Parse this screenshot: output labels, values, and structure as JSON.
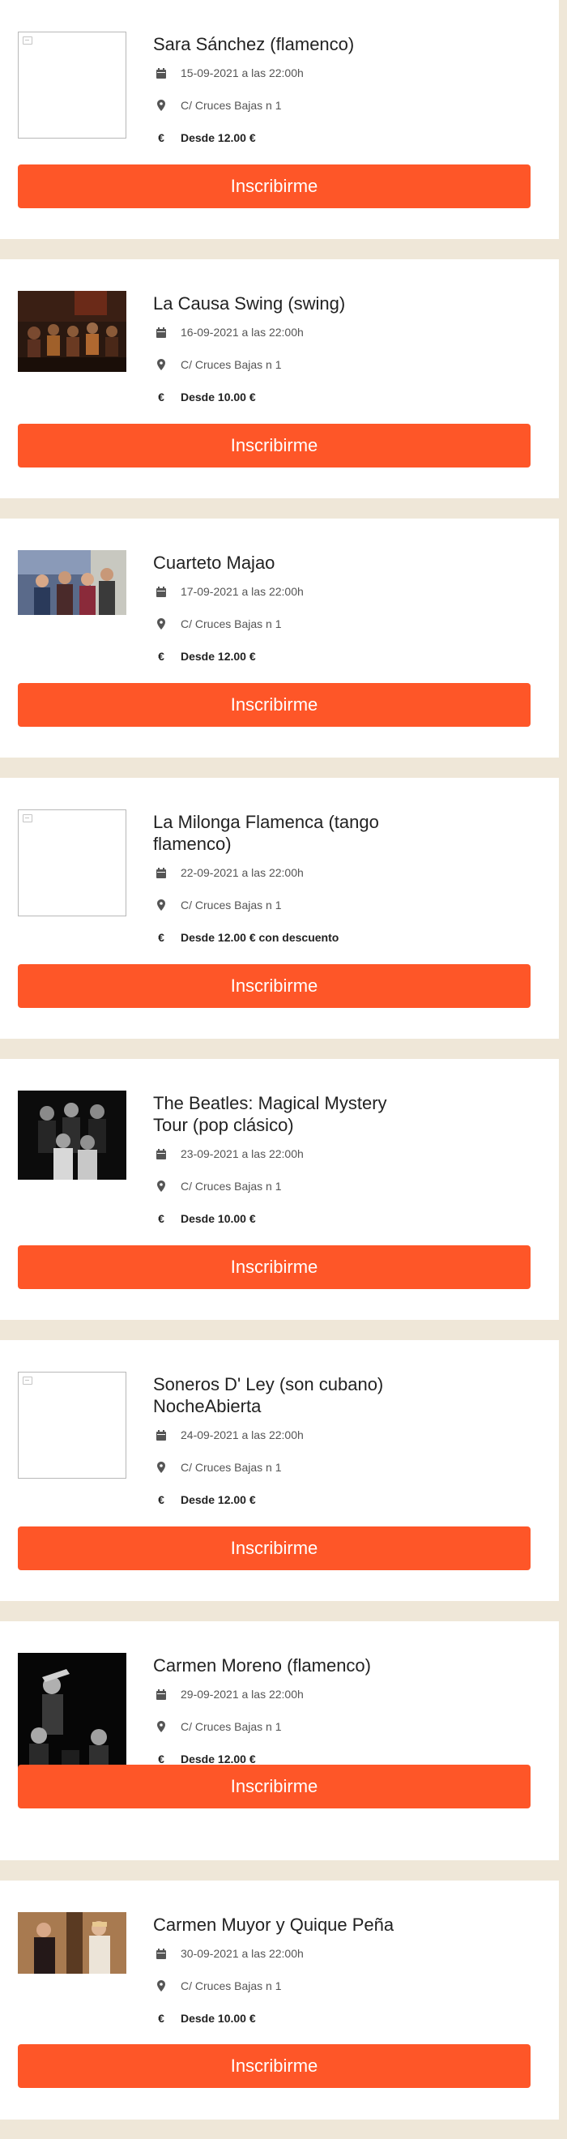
{
  "colors": {
    "accent": "#fe5628",
    "page_background": "#efe7d8",
    "card_background": "#ffffff"
  },
  "icons": {
    "date": "calendar-icon",
    "venue": "map-marker-icon",
    "price": "euro-icon",
    "missing_image": "broken-image-icon"
  },
  "events": [
    {
      "title": "Sara Sánchez (flamenco)",
      "date_text": "15-09-2021 a las 22:00h",
      "venue": "C/ Cruces Bajas n 1",
      "price_text": "Desde 12.00 €",
      "cta_label": "Inscribirme",
      "image": "broken"
    },
    {
      "title": "La Causa Swing (swing)",
      "date_text": "16-09-2021 a las 22:00h",
      "venue": "C/ Cruces Bajas n 1",
      "price_text": "Desde 10.00 €",
      "cta_label": "Inscribirme",
      "image": "band-on-stage-photo"
    },
    {
      "title": "Cuarteto Majao",
      "date_text": "17-09-2021 a las 22:00h",
      "venue": "C/ Cruces Bajas n 1",
      "price_text": "Desde 12.00 €",
      "cta_label": "Inscribirme",
      "image": "quartet-photo"
    },
    {
      "title": "La Milonga Flamenca (tango flamenco)",
      "date_text": "22-09-2021 a las 22:00h",
      "venue": "C/ Cruces Bajas n 1",
      "price_text": "Desde 12.00 € con descuento",
      "cta_label": "Inscribirme",
      "image": "broken"
    },
    {
      "title": "The Beatles: Magical Mystery Tour (pop clásico)",
      "date_text": "23-09-2021 a las 22:00h",
      "venue": "C/ Cruces Bajas n 1",
      "price_text": "Desde 10.00 €",
      "cta_label": "Inscribirme",
      "image": "group-portrait-bw-photo"
    },
    {
      "title": "Soneros D' Ley (son cubano) NocheAbierta",
      "date_text": "24-09-2021 a las 22:00h",
      "venue": "C/ Cruces Bajas n 1",
      "price_text": "Desde 12.00 €",
      "cta_label": "Inscribirme",
      "image": "broken"
    },
    {
      "title": "Carmen Moreno (flamenco)",
      "date_text": "29-09-2021 a las 22:00h",
      "venue": "C/ Cruces Bajas n 1",
      "price_text": "Desde 12.00 €",
      "cta_label": "Inscribirme",
      "image": "bw-concert-photo"
    },
    {
      "title": "Carmen Muyor y Quique Peña",
      "date_text": "30-09-2021 a las 22:00h",
      "venue": "C/ Cruces Bajas n 1",
      "price_text": "Desde 10.00 €",
      "cta_label": "Inscribirme",
      "image": "duo-photo"
    }
  ]
}
